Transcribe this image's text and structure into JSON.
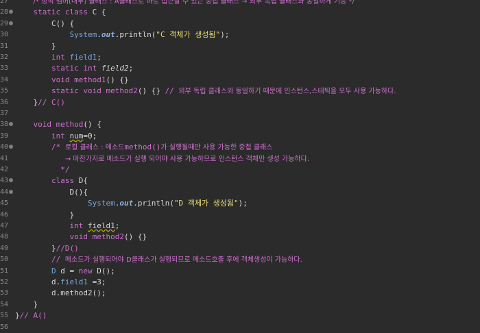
{
  "lines": [
    {
      "n": "27",
      "fold": false,
      "indent": "    ",
      "tokens": [
        [
          "cm",
          "/* 정적 멤버(내부) 클래스 : A클래스로 바로 접근할 수 있는 중첩 클래스 → 외부 독립 클래스와 동일하게 기능 */"
        ]
      ]
    },
    {
      "n": "28",
      "fold": true,
      "indent": "    ",
      "tokens": [
        [
          "kw2",
          "static class "
        ],
        [
          "id",
          "C {"
        ]
      ]
    },
    {
      "n": "29",
      "fold": true,
      "indent": "        ",
      "tokens": [
        [
          "id",
          "C() {"
        ]
      ]
    },
    {
      "n": "30",
      "fold": false,
      "indent": "            ",
      "tokens": [
        [
          "fld",
          "System"
        ],
        [
          "id",
          "."
        ],
        [
          "out",
          "out"
        ],
        [
          "id",
          ".println("
        ],
        [
          "str",
          "\"C 객체가 생성됨\""
        ],
        [
          "id",
          ");"
        ]
      ]
    },
    {
      "n": "31",
      "fold": false,
      "indent": "        ",
      "tokens": [
        [
          "id",
          "}"
        ]
      ]
    },
    {
      "n": "32",
      "fold": false,
      "indent": "        ",
      "tokens": [
        [
          "kw2",
          "int "
        ],
        [
          "fld",
          "field1"
        ],
        [
          "id",
          ";"
        ]
      ]
    },
    {
      "n": "33",
      "fold": false,
      "indent": "        ",
      "tokens": [
        [
          "kw2",
          "static int "
        ],
        [
          "ital",
          "field2"
        ],
        [
          "id",
          ";"
        ]
      ]
    },
    {
      "n": "34",
      "fold": false,
      "indent": "        ",
      "tokens": [
        [
          "kw2",
          "void "
        ],
        [
          "kw2",
          "method1"
        ],
        [
          "id",
          "() {}"
        ]
      ]
    },
    {
      "n": "35",
      "fold": false,
      "indent": "        ",
      "tokens": [
        [
          "kw2",
          "static void "
        ],
        [
          "kw2",
          "method2"
        ],
        [
          "id",
          "() {} "
        ],
        [
          "cmk",
          "// "
        ],
        [
          "cm",
          "외부 독립 클래스와 동일하기 때문에 인스턴스,스태틱을 모두 사용 가능하다."
        ]
      ]
    },
    {
      "n": "36",
      "fold": false,
      "indent": "    ",
      "tokens": [
        [
          "id",
          "}"
        ],
        [
          "cmk",
          "// C()"
        ]
      ]
    },
    {
      "n": "37",
      "fold": false,
      "indent": "",
      "tokens": []
    },
    {
      "n": "38",
      "fold": true,
      "indent": "    ",
      "tokens": [
        [
          "kw2",
          "void "
        ],
        [
          "kw2",
          "method"
        ],
        [
          "id",
          "() {"
        ]
      ]
    },
    {
      "n": "39",
      "fold": false,
      "indent": "        ",
      "tokens": [
        [
          "kw2",
          "int "
        ],
        [
          "warn",
          "num"
        ],
        [
          "id",
          "=0;"
        ]
      ]
    },
    {
      "n": "40",
      "fold": true,
      "indent": "        ",
      "tokens": [
        [
          "cmk",
          "/* "
        ],
        [
          "cm",
          "로컬 클래스 : 메소드"
        ],
        [
          "cmk",
          "method()"
        ],
        [
          "cm",
          "가 실행될때만 사용 가능한 중첩 클래스"
        ]
      ]
    },
    {
      "n": "41",
      "fold": false,
      "indent": "           ",
      "tokens": [
        [
          "cm",
          "→ 마찬가지로 메소드가 실행 되어야 사용 가능하므로 인스턴스 객체만 생성 가능하다."
        ]
      ]
    },
    {
      "n": "42",
      "fold": false,
      "indent": "          ",
      "tokens": [
        [
          "cmk",
          "*/"
        ]
      ]
    },
    {
      "n": "43",
      "fold": true,
      "indent": "        ",
      "tokens": [
        [
          "kw2",
          "class "
        ],
        [
          "id",
          "D{"
        ]
      ]
    },
    {
      "n": "44",
      "fold": true,
      "indent": "            ",
      "tokens": [
        [
          "id",
          "D(){"
        ]
      ]
    },
    {
      "n": "45",
      "fold": false,
      "indent": "                ",
      "tokens": [
        [
          "fld",
          "System"
        ],
        [
          "id",
          "."
        ],
        [
          "out",
          "out"
        ],
        [
          "id",
          ".println("
        ],
        [
          "str",
          "\"D 객체가 생성됨\""
        ],
        [
          "id",
          ");"
        ]
      ]
    },
    {
      "n": "46",
      "fold": false,
      "indent": "            ",
      "tokens": [
        [
          "id",
          "}"
        ]
      ]
    },
    {
      "n": "47",
      "fold": false,
      "indent": "            ",
      "tokens": [
        [
          "kw2",
          "int "
        ],
        [
          "warn",
          "field1"
        ],
        [
          "id",
          ";"
        ]
      ]
    },
    {
      "n": "48",
      "fold": false,
      "indent": "            ",
      "tokens": [
        [
          "kw2",
          "void "
        ],
        [
          "kw2",
          "method2"
        ],
        [
          "id",
          "() {}"
        ]
      ]
    },
    {
      "n": "49",
      "fold": false,
      "indent": "        ",
      "tokens": [
        [
          "id",
          "}"
        ],
        [
          "cmk",
          "//D()"
        ]
      ]
    },
    {
      "n": "50",
      "fold": false,
      "indent": "        ",
      "tokens": [
        [
          "cmk",
          "// "
        ],
        [
          "cm",
          "메소드가 실행되어야 D클래스가 실행되므로 메소드호출 후에 객체생성이 가능하다."
        ]
      ]
    },
    {
      "n": "51",
      "fold": false,
      "indent": "        ",
      "tokens": [
        [
          "fld",
          "D "
        ],
        [
          "id",
          "d = "
        ],
        [
          "kw2",
          "new "
        ],
        [
          "id",
          "D();"
        ]
      ]
    },
    {
      "n": "52",
      "fold": false,
      "indent": "        ",
      "tokens": [
        [
          "id",
          "d."
        ],
        [
          "fld",
          "field1"
        ],
        [
          "id",
          " =3;"
        ]
      ]
    },
    {
      "n": "53",
      "fold": false,
      "indent": "        ",
      "tokens": [
        [
          "id",
          "d.method2();"
        ]
      ]
    },
    {
      "n": "54",
      "fold": false,
      "indent": "    ",
      "tokens": [
        [
          "id",
          "}"
        ]
      ]
    },
    {
      "n": "55",
      "fold": false,
      "indent": "",
      "tokens": [
        [
          "id",
          "}"
        ],
        [
          "cmk",
          "// A()"
        ]
      ]
    },
    {
      "n": "56",
      "fold": false,
      "indent": "",
      "tokens": []
    }
  ],
  "colors": {
    "background": "#2b2b2b",
    "keyword": "#d070d0",
    "string": "#e6db74",
    "field": "#7aa6da"
  }
}
